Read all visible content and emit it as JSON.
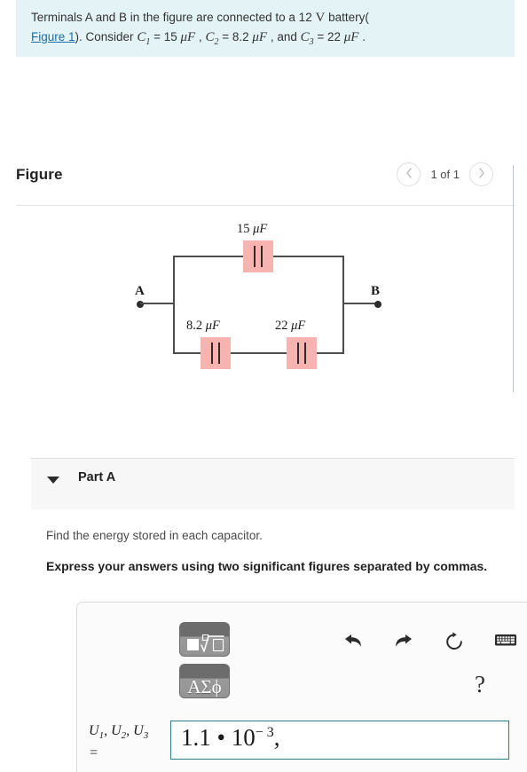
{
  "problem": {
    "line1_a": "Terminals A and B in the figure are connected to a 12 ",
    "line1_volt": "V",
    "line1_b": " battery(",
    "figure_link": "Figure 1",
    "line2_a": "). Consider ",
    "c1_sym": "C",
    "c1_sub": "1",
    "c1_eq": " = 15 ",
    "c1_unit": "μF",
    "sep1": " , ",
    "c2_sym": "C",
    "c2_sub": "2",
    "c2_eq": " = 8.2 ",
    "c2_unit": "μF",
    "sep2": " , and ",
    "c3_sym": "C",
    "c3_sub": "3",
    "c3_eq": " = 22 ",
    "c3_unit": "μF",
    "period": " ."
  },
  "figure": {
    "title": "Figure",
    "pager_prev": "‹",
    "pager_count": "1 of 1",
    "pager_next": "›",
    "circuit": {
      "terminal_a": "A",
      "terminal_b": "B",
      "cap_top_value": "15",
      "cap_top_unit": "μF",
      "cap_bottom_left_value": "8.2",
      "cap_bottom_left_unit": "μF",
      "cap_bottom_right_value": "22",
      "cap_bottom_right_unit": "μF",
      "highlight_color": "#f7b3b0",
      "wire_color": "#4d4d4d"
    }
  },
  "part_a": {
    "title": "Part A",
    "question": "Find the energy stored in each capacitor.",
    "instruction": "Express your answers using two significant figures separated by commas.",
    "answer": {
      "label_u": "U",
      "label_sub1": "1",
      "label_sub2": "2",
      "label_sub3": "3",
      "label_comma": ", ",
      "label_equals": "=",
      "value_mantissa": "1.1 • 10",
      "value_exponent": "− 3",
      "value_trailing": ",",
      "border_color": "#2d7d92"
    },
    "palette": {
      "sqrt_button": "sqrt-template-button",
      "greek_button": "ΑΣϕ"
    },
    "tools": {
      "undo": "undo-icon",
      "redo": "redo-icon",
      "reset": "reset-icon",
      "keyboard": "keyboard-icon",
      "help": "?"
    }
  }
}
